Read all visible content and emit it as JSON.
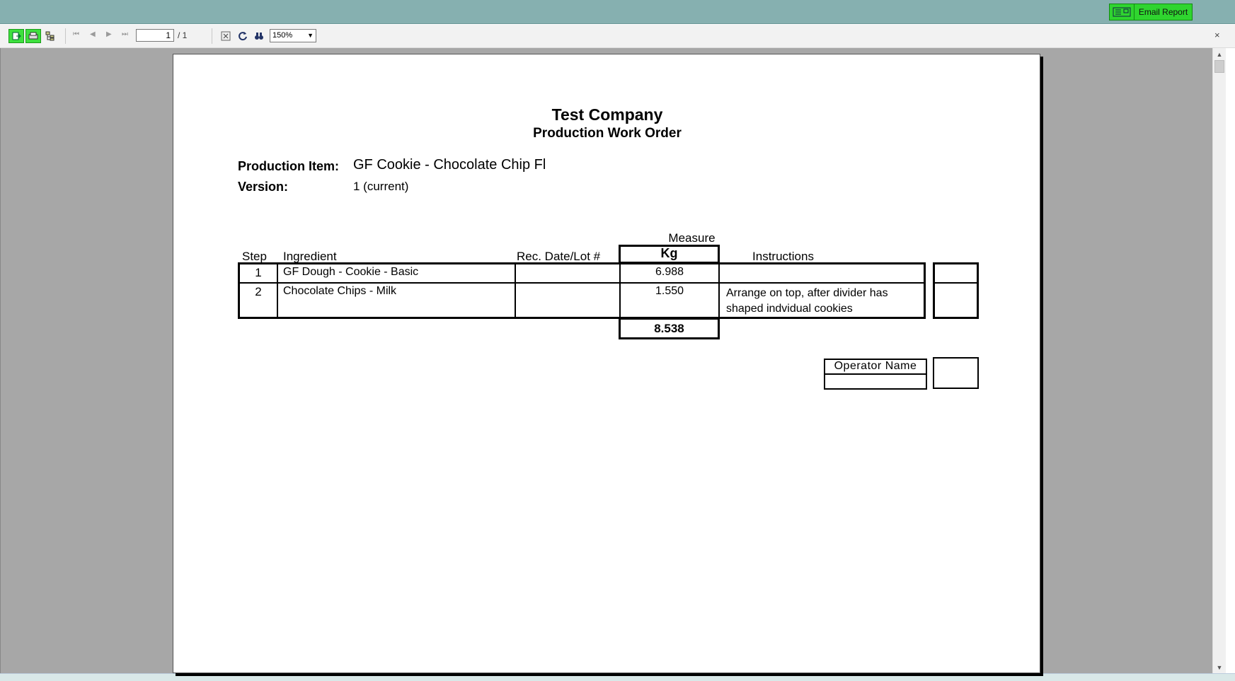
{
  "topbar": {
    "email_label": "Email Report",
    "email_icon": "envelope-icon"
  },
  "toolbar": {
    "export_icon": "export-icon",
    "print_icon": "print-icon",
    "tree_icon": "group-tree-icon",
    "first_icon": "first-page-icon",
    "prev_icon": "prev-page-icon",
    "next_icon": "next-page-icon",
    "last_icon": "last-page-icon",
    "page_value": "1",
    "page_total": "/ 1",
    "stop_icon": "stop-icon",
    "refresh_icon": "refresh-icon",
    "find_icon": "binoculars-icon",
    "zoom_value": "150%",
    "close_glyph": "×"
  },
  "report": {
    "company": "Test Company",
    "title": "Production Work Order",
    "production_item_label": "Production Item:",
    "production_item_value": "GF Cookie - Chocolate Chip Fl",
    "version_label": "Version:",
    "version_value": "1 (current)",
    "columns": {
      "step": "Step",
      "ingredient": "Ingredient",
      "rec_date": "Rec. Date/Lot #",
      "measure": "Measure",
      "unit": "Kg",
      "instructions": "Instructions"
    },
    "rows": [
      {
        "step": "1",
        "ingredient": "GF Dough - Cookie - Basic",
        "rec": "",
        "measure": "6.988",
        "instructions_line1": "",
        "instructions_line2": ""
      },
      {
        "step": "2",
        "ingredient": "Chocolate Chips - Milk",
        "rec": "",
        "measure": "1.550",
        "instructions_line1": "Arrange on top, after divider has",
        "instructions_line2": "shaped indvidual cookies"
      }
    ],
    "total": "8.538",
    "operator_label": "Operator Name"
  }
}
